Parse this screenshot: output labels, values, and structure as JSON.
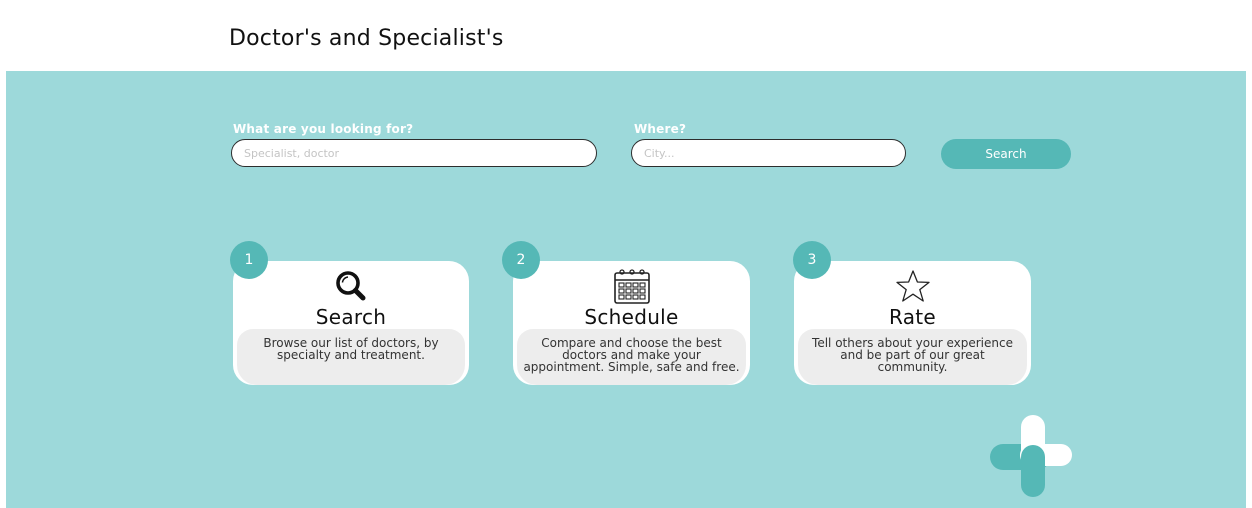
{
  "page": {
    "title": "Doctor's and Specialist's"
  },
  "search": {
    "what_label": "What are you looking for?",
    "what_placeholder": "Specialist, doctor",
    "where_label": "Where?",
    "where_placeholder": "City...",
    "button_label": "Search"
  },
  "steps": [
    {
      "number": "1",
      "title": "Search",
      "description": "Browse our list of doctors, by specialty and treatment.",
      "icon": "magnifier-icon"
    },
    {
      "number": "2",
      "title": "Schedule",
      "description": "Compare and choose the best doctors and make your appointment. Simple, safe and free.",
      "icon": "calendar-icon"
    },
    {
      "number": "3",
      "title": "Rate",
      "description": "Tell others about your experience and be part of our great community.",
      "icon": "star-icon"
    }
  ],
  "logo": {
    "icon": "medical-cross-logo"
  },
  "colors": {
    "hero_background": "#9dd9da",
    "accent": "#55b8b6",
    "card_background": "#ffffff",
    "card_description_background": "#ededed"
  }
}
